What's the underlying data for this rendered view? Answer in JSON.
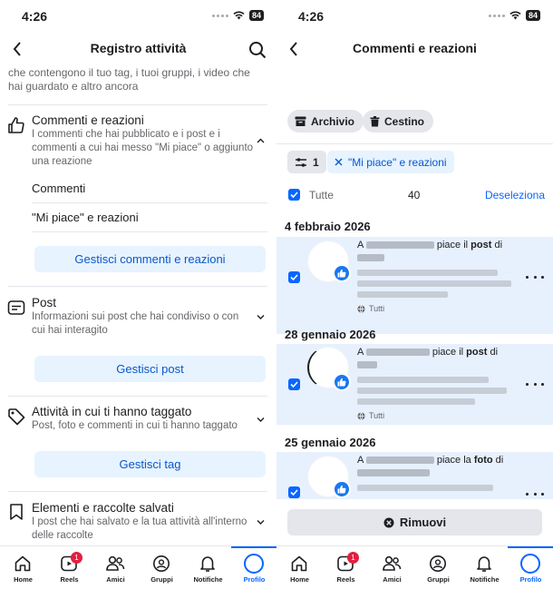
{
  "left": {
    "status": {
      "time": "4:26",
      "battery": "84"
    },
    "title": "Registro attività",
    "intro": "che contengono il tuo tag, i tuoi gruppi, i video che hai guardato e altro ancora",
    "sections": [
      {
        "title": "Commenti e reazioni",
        "desc": "I commenti che hai pubblicato e i post e i commenti a cui hai messo \"Mi piace\" o aggiunto una reazione",
        "subitems": [
          "Commenti",
          "\"Mi piace\" e reazioni"
        ],
        "button": "Gestisci commenti e reazioni"
      },
      {
        "title": "Post",
        "desc": "Informazioni sui post che hai condiviso o con cui hai interagito",
        "button": "Gestisci post"
      },
      {
        "title": "Attività in cui ti hanno taggato",
        "desc": "Post, foto e commenti in cui ti hanno taggato",
        "button": "Gestisci tag"
      },
      {
        "title": "Elementi e raccolte salvati",
        "desc": "I post che hai salvato e la tua attività all'interno delle raccolte"
      }
    ]
  },
  "right": {
    "status": {
      "time": "4:26",
      "battery": "84"
    },
    "title": "Commenti e reazioni",
    "chips": {
      "archive": "Archivio",
      "trash": "Cestino"
    },
    "filter_count": "1",
    "filter_label": "\"Mi piace\" e reazioni",
    "select_all": {
      "label": "Tutte",
      "count": "40",
      "deselect": "Deseleziona"
    },
    "groups": [
      {
        "date": "4 febbraio 2026",
        "prefix": "A",
        "verb": "piace il",
        "object": "post",
        "suffix": "di",
        "audience": "Tutti"
      },
      {
        "date": "28 gennaio 2026",
        "prefix": "A",
        "verb": "piace il",
        "object": "post",
        "suffix": "di",
        "audience": "Tutti"
      },
      {
        "date": "25 gennaio 2026",
        "prefix": "A",
        "verb": "piace la",
        "object": "foto",
        "suffix": "di",
        "audience": ""
      }
    ],
    "remove_label": "Rimuovi"
  },
  "tabbar": {
    "items": [
      "Home",
      "Reels",
      "Amici",
      "Gruppi",
      "Notifiche",
      "Profilo"
    ],
    "reels_badge": "1"
  },
  "colors": {
    "accent": "#0866ff",
    "selected_row": "#e7f0fd",
    "button_bg": "#e7f3ff",
    "badge": "#e41e3f"
  }
}
